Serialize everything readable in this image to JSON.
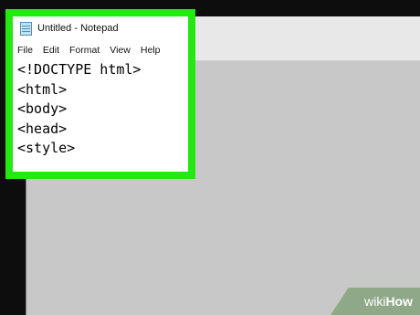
{
  "notepad": {
    "title": "Untitled - Notepad",
    "menu": [
      "File",
      "Edit",
      "Format",
      "View",
      "Help"
    ],
    "lines": [
      "<!DOCTYPE html>",
      "<html>",
      "<body>",
      "<head>",
      "<style>"
    ]
  },
  "watermark": {
    "prefix": "wiki",
    "suffix": "How"
  },
  "colors": {
    "highlight": "#22e90f",
    "background_window": "#c8c8c8"
  }
}
